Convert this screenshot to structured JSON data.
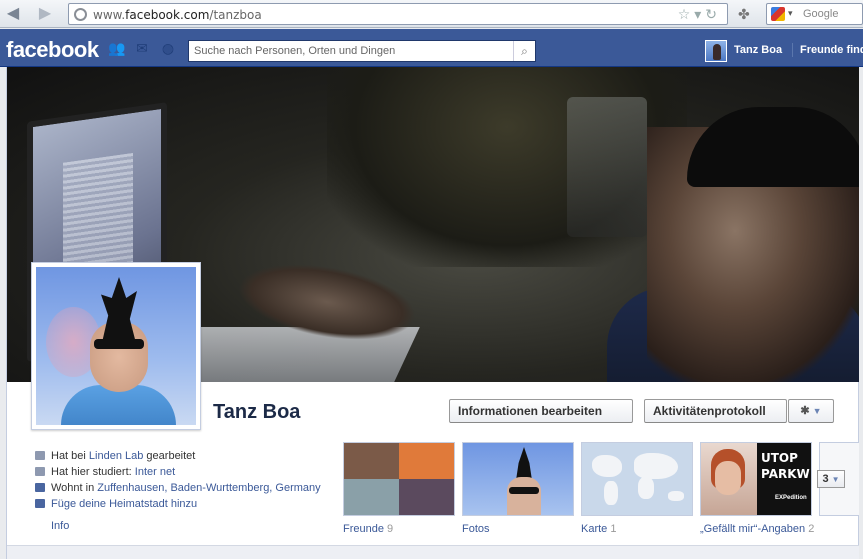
{
  "browser": {
    "url_prefix": "www.",
    "url_domain": "facebook.com",
    "url_path": "/tanzboa",
    "search_engine_label": "Google"
  },
  "fb": {
    "logo": "facebook",
    "search_placeholder": "Suche nach Personen, Orten und Dingen",
    "user_name": "Tanz Boa",
    "friends_link": "Freunde finden"
  },
  "profile": {
    "name": "Tanz Boa",
    "edit_button": "Informationen bearbeiten",
    "activity_button": "Aktivitätenprotokoll",
    "info": [
      {
        "prefix": "Hat bei ",
        "link": "Linden Lab",
        "suffix": " gearbeitet"
      },
      {
        "prefix": "Hat hier studiert: ",
        "link": "Inter net",
        "suffix": ""
      },
      {
        "prefix": "Wohnt in ",
        "link": "Zuffenhausen, Baden-Wurttemberg, Germany",
        "suffix": ""
      },
      {
        "prefix": "",
        "link": "Füge deine Heimatstadt hinzu",
        "suffix": ""
      }
    ],
    "info_link": "Info"
  },
  "tiles": {
    "friends": {
      "label": "Freunde",
      "count": "9"
    },
    "photos": {
      "label": "Fotos"
    },
    "map": {
      "label": "Karte",
      "count": "1"
    },
    "likes": {
      "label": "„Gefällt mir“-Angaben",
      "count": "2"
    },
    "likes_image_text": [
      "UTOP",
      "PARKW",
      "EXPedition"
    ],
    "more_count": "3"
  },
  "colors": {
    "fb_blue": "#3b5998",
    "link": "#3b5998",
    "name": "#1c2a47"
  }
}
